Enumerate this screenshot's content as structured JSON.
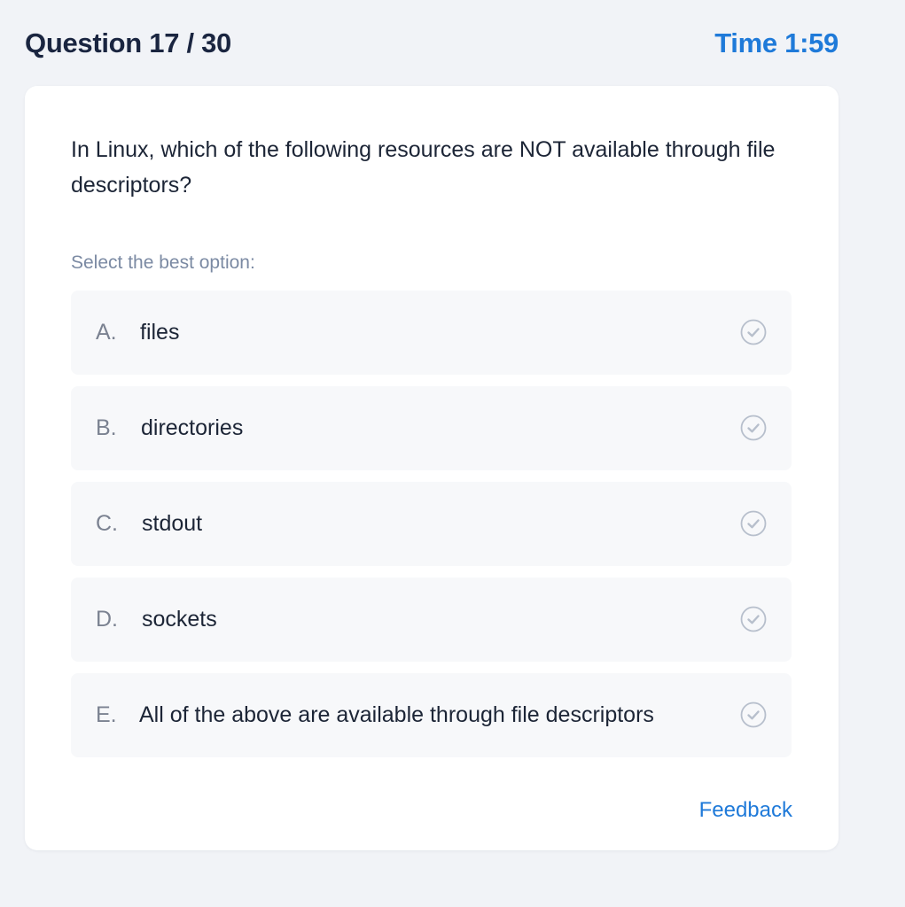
{
  "header": {
    "question_counter": "Question 17 / 30",
    "timer": "Time 1:59"
  },
  "question": {
    "text": "In Linux, which of the following resources are NOT available through file descriptors?",
    "instruction": "Select the best option:"
  },
  "options": [
    {
      "letter": "A.",
      "text": "files",
      "icon": "check-circle-icon"
    },
    {
      "letter": "B.",
      "text": "directories",
      "icon": "check-circle-icon"
    },
    {
      "letter": "C.",
      "text": "stdout",
      "icon": "check-circle-icon"
    },
    {
      "letter": "D.",
      "text": "sockets",
      "icon": "check-circle-icon"
    },
    {
      "letter": "E.",
      "text": "All of the above are available through file descriptors",
      "icon": "check-circle-icon"
    }
  ],
  "footer": {
    "feedback_label": "Feedback"
  },
  "colors": {
    "accent": "#1f7ad9",
    "background": "#f1f3f7",
    "option_background": "#f7f8fa",
    "check_icon": "#b7bfcc"
  }
}
